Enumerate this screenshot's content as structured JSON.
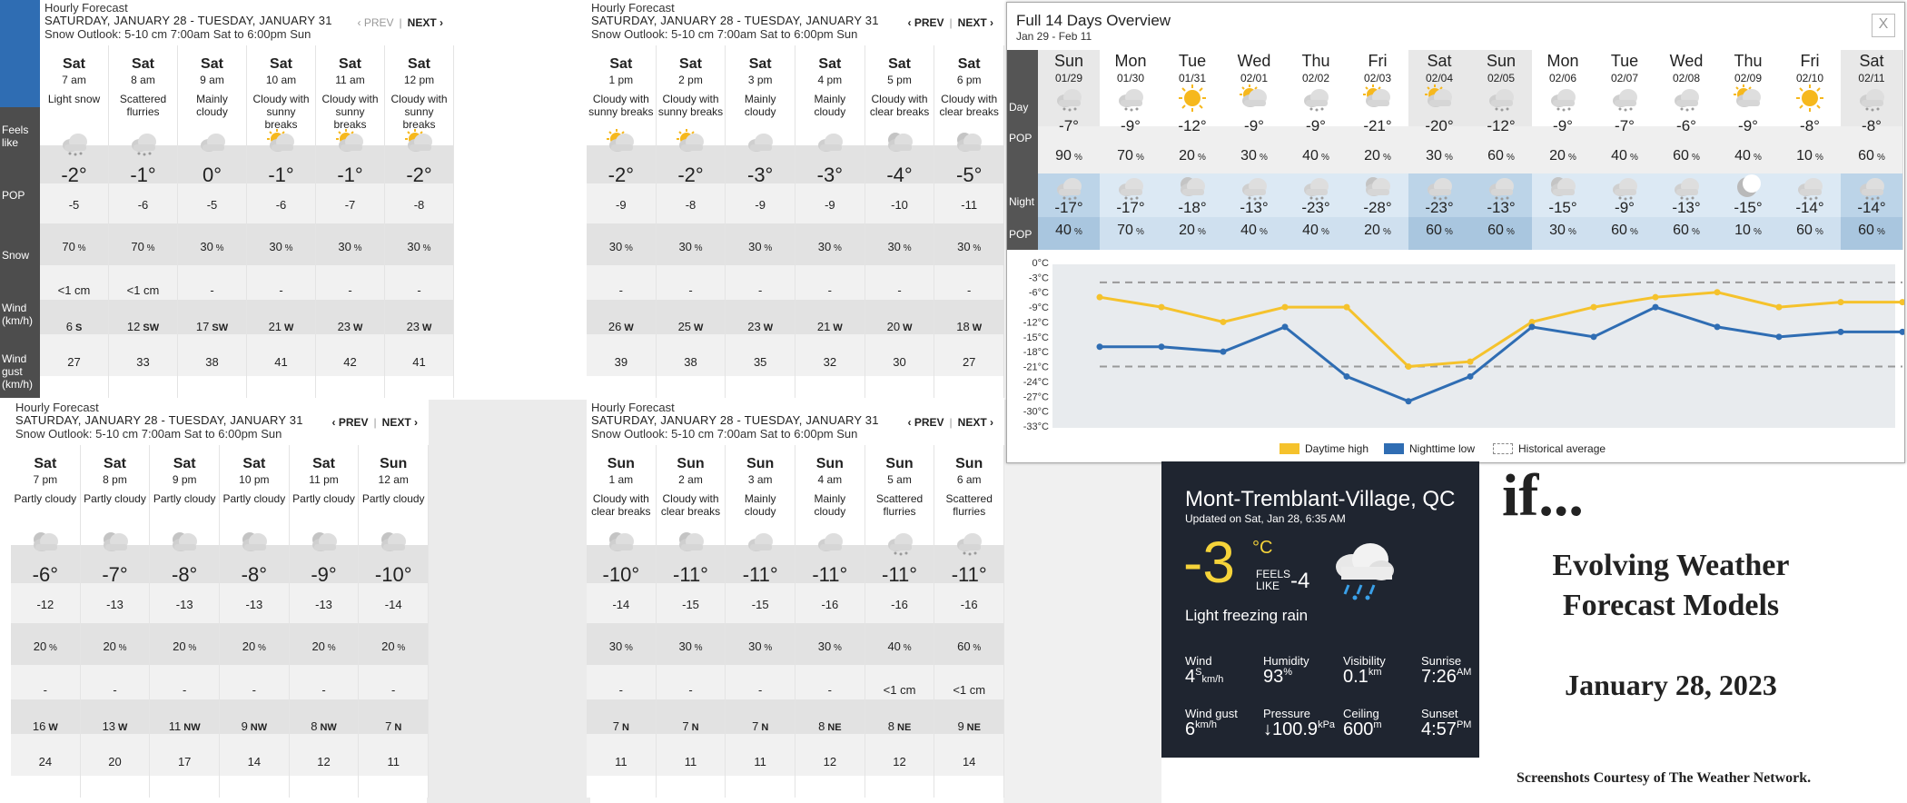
{
  "row_labels": {
    "feels": "Feels like",
    "pop": "POP",
    "snow": "Snow",
    "wind": "Wind (km/h)",
    "gust": "Wind gust (km/h)"
  },
  "hourly_panels": [
    {
      "title": "Hourly Forecast",
      "dates": "SATURDAY, JANUARY 28 - TUESDAY, JANUARY 31",
      "outlook": "Snow Outlook: 5-10 cm 7:00am Sat to 6:00pm Sun",
      "prev": "‹ PREV",
      "next": "NEXT ›",
      "sep": "|",
      "hours": [
        {
          "day": "Sat",
          "hour": "7 am",
          "cond": "Light snow",
          "icon": "snow-cloud-icon",
          "temp": "-2°",
          "feels": "-5",
          "pop": "70",
          "snow": "<1 cm",
          "wind": "6",
          "dir": "S",
          "gust": "27"
        },
        {
          "day": "Sat",
          "hour": "8 am",
          "cond": "Scattered flurries",
          "icon": "flurries-icon",
          "temp": "-1°",
          "feels": "-6",
          "pop": "70",
          "snow": "<1 cm",
          "wind": "12",
          "dir": "SW",
          "gust": "33"
        },
        {
          "day": "Sat",
          "hour": "9 am",
          "cond": "Mainly cloudy",
          "icon": "cloud-icon",
          "temp": "0°",
          "feels": "-5",
          "pop": "30",
          "snow": "-",
          "wind": "17",
          "dir": "SW",
          "gust": "38"
        },
        {
          "day": "Sat",
          "hour": "10 am",
          "cond": "Cloudy with sunny breaks",
          "icon": "sun-cloud-icon",
          "temp": "-1°",
          "feels": "-6",
          "pop": "30",
          "snow": "-",
          "wind": "21",
          "dir": "W",
          "gust": "41"
        },
        {
          "day": "Sat",
          "hour": "11 am",
          "cond": "Cloudy with sunny breaks",
          "icon": "sun-cloud-icon",
          "temp": "-1°",
          "feels": "-7",
          "pop": "30",
          "snow": "-",
          "wind": "23",
          "dir": "W",
          "gust": "42"
        },
        {
          "day": "Sat",
          "hour": "12 pm",
          "cond": "Cloudy with sunny breaks",
          "icon": "sun-cloud-icon",
          "temp": "-2°",
          "feels": "-8",
          "pop": "30",
          "snow": "-",
          "wind": "23",
          "dir": "W",
          "gust": "41"
        }
      ]
    },
    {
      "title": "Hourly Forecast",
      "dates": "SATURDAY, JANUARY 28 - TUESDAY, JANUARY 31",
      "outlook": "Snow Outlook: 5-10 cm 7:00am Sat to 6:00pm Sun",
      "prev": "‹ PREV",
      "next": "NEXT ›",
      "sep": "|",
      "hours": [
        {
          "day": "Sat",
          "hour": "1 pm",
          "cond": "Cloudy with sunny breaks",
          "icon": "sun-cloud-icon",
          "temp": "-2°",
          "feels": "-9",
          "pop": "30",
          "snow": "-",
          "wind": "26",
          "dir": "W",
          "gust": "39"
        },
        {
          "day": "Sat",
          "hour": "2 pm",
          "cond": "Cloudy with sunny breaks",
          "icon": "sun-cloud-icon",
          "temp": "-2°",
          "feels": "-8",
          "pop": "30",
          "snow": "-",
          "wind": "25",
          "dir": "W",
          "gust": "38"
        },
        {
          "day": "Sat",
          "hour": "3 pm",
          "cond": "Mainly cloudy",
          "icon": "cloud-icon",
          "temp": "-3°",
          "feels": "-9",
          "pop": "30",
          "snow": "-",
          "wind": "23",
          "dir": "W",
          "gust": "35"
        },
        {
          "day": "Sat",
          "hour": "4 pm",
          "cond": "Mainly cloudy",
          "icon": "cloud-icon",
          "temp": "-3°",
          "feels": "-9",
          "pop": "30",
          "snow": "-",
          "wind": "21",
          "dir": "W",
          "gust": "32"
        },
        {
          "day": "Sat",
          "hour": "5 pm",
          "cond": "Cloudy with clear breaks",
          "icon": "moon-cloud-icon",
          "temp": "-4°",
          "feels": "-10",
          "pop": "30",
          "snow": "-",
          "wind": "20",
          "dir": "W",
          "gust": "30"
        },
        {
          "day": "Sat",
          "hour": "6 pm",
          "cond": "Cloudy with clear breaks",
          "icon": "moon-cloud-icon",
          "temp": "-5°",
          "feels": "-11",
          "pop": "30",
          "snow": "-",
          "wind": "18",
          "dir": "W",
          "gust": "27"
        }
      ]
    },
    {
      "title": "Hourly Forecast",
      "dates": "SATURDAY, JANUARY 28 - TUESDAY, JANUARY 31",
      "outlook": "Snow Outlook: 5-10 cm 7:00am Sat to 6:00pm Sun",
      "prev": "‹ PREV",
      "next": "NEXT ›",
      "sep": "|",
      "hours": [
        {
          "day": "Sat",
          "hour": "7 pm",
          "cond": "Partly cloudy",
          "icon": "moon-cloud-icon",
          "temp": "-6°",
          "feels": "-12",
          "pop": "20",
          "snow": "-",
          "wind": "16",
          "dir": "W",
          "gust": "24"
        },
        {
          "day": "Sat",
          "hour": "8 pm",
          "cond": "Partly cloudy",
          "icon": "moon-cloud-icon",
          "temp": "-7°",
          "feels": "-13",
          "pop": "20",
          "snow": "-",
          "wind": "13",
          "dir": "W",
          "gust": "20"
        },
        {
          "day": "Sat",
          "hour": "9 pm",
          "cond": "Partly cloudy",
          "icon": "moon-cloud-icon",
          "temp": "-8°",
          "feels": "-13",
          "pop": "20",
          "snow": "-",
          "wind": "11",
          "dir": "NW",
          "gust": "17"
        },
        {
          "day": "Sat",
          "hour": "10 pm",
          "cond": "Partly cloudy",
          "icon": "moon-cloud-icon",
          "temp": "-8°",
          "feels": "-13",
          "pop": "20",
          "snow": "-",
          "wind": "9",
          "dir": "NW",
          "gust": "14"
        },
        {
          "day": "Sat",
          "hour": "11 pm",
          "cond": "Partly cloudy",
          "icon": "moon-cloud-icon",
          "temp": "-9°",
          "feels": "-13",
          "pop": "20",
          "snow": "-",
          "wind": "8",
          "dir": "NW",
          "gust": "12"
        },
        {
          "day": "Sun",
          "hour": "12 am",
          "cond": "Partly cloudy",
          "icon": "moon-cloud-icon",
          "temp": "-10°",
          "feels": "-14",
          "pop": "20",
          "snow": "-",
          "wind": "7",
          "dir": "N",
          "gust": "11"
        }
      ]
    },
    {
      "title": "Hourly Forecast",
      "dates": "SATURDAY, JANUARY 28 - TUESDAY, JANUARY 31",
      "outlook": "Snow Outlook: 5-10 cm 7:00am Sat to 6:00pm Sun",
      "prev": "‹ PREV",
      "next": "NEXT ›",
      "sep": "|",
      "hours": [
        {
          "day": "Sun",
          "hour": "1 am",
          "cond": "Cloudy with clear breaks",
          "icon": "moon-cloud-icon",
          "temp": "-10°",
          "feels": "-14",
          "pop": "30",
          "snow": "-",
          "wind": "7",
          "dir": "N",
          "gust": "11"
        },
        {
          "day": "Sun",
          "hour": "2 am",
          "cond": "Cloudy with clear breaks",
          "icon": "moon-cloud-icon",
          "temp": "-11°",
          "feels": "-15",
          "pop": "30",
          "snow": "-",
          "wind": "7",
          "dir": "N",
          "gust": "11"
        },
        {
          "day": "Sun",
          "hour": "3 am",
          "cond": "Mainly cloudy",
          "icon": "cloud-icon",
          "temp": "-11°",
          "feels": "-15",
          "pop": "30",
          "snow": "-",
          "wind": "7",
          "dir": "N",
          "gust": "11"
        },
        {
          "day": "Sun",
          "hour": "4 am",
          "cond": "Mainly cloudy",
          "icon": "cloud-icon",
          "temp": "-11°",
          "feels": "-16",
          "pop": "30",
          "snow": "-",
          "wind": "8",
          "dir": "NE",
          "gust": "12"
        },
        {
          "day": "Sun",
          "hour": "5 am",
          "cond": "Scattered flurries",
          "icon": "flurries-icon",
          "temp": "-11°",
          "feels": "-16",
          "pop": "40",
          "snow": "<1 cm",
          "wind": "8",
          "dir": "NE",
          "gust": "12"
        },
        {
          "day": "Sun",
          "hour": "6 am",
          "cond": "Scattered flurries",
          "icon": "flurries-icon",
          "temp": "-11°",
          "feels": "-16",
          "pop": "60",
          "snow": "<1 cm",
          "wind": "9",
          "dir": "NE",
          "gust": "14"
        }
      ]
    }
  ],
  "overview": {
    "title": "Full 14 Days Overview",
    "subtitle": "Jan 29 - Feb 11",
    "close": "X",
    "labels": {
      "day": "Day",
      "pop": "POP",
      "night": "Night",
      "npop": "POP"
    },
    "pct": "%",
    "days": [
      {
        "dow": "Sun",
        "date": "01/29",
        "day_icon": "snow-cloud-icon",
        "high": "-7°",
        "dpop": "90",
        "night_icon": "snow-cloud-icon",
        "low": "-17°",
        "npop": "40"
      },
      {
        "dow": "Mon",
        "date": "01/30",
        "day_icon": "snow-cloud-icon",
        "high": "-9°",
        "dpop": "70",
        "night_icon": "snow-cloud-icon",
        "low": "-17°",
        "npop": "70"
      },
      {
        "dow": "Tue",
        "date": "01/31",
        "day_icon": "sun-icon",
        "high": "-12°",
        "dpop": "20",
        "night_icon": "moon-cloud-icon",
        "low": "-18°",
        "npop": "20"
      },
      {
        "dow": "Wed",
        "date": "02/01",
        "day_icon": "sun-cloud-icon",
        "high": "-9°",
        "dpop": "30",
        "night_icon": "snow-cloud-icon",
        "low": "-13°",
        "npop": "40"
      },
      {
        "dow": "Thu",
        "date": "02/02",
        "day_icon": "snow-cloud-icon",
        "high": "-9°",
        "dpop": "40",
        "night_icon": "snow-cloud-icon",
        "low": "-23°",
        "npop": "40"
      },
      {
        "dow": "Fri",
        "date": "02/03",
        "day_icon": "sun-cloud-icon",
        "high": "-21°",
        "dpop": "20",
        "night_icon": "moon-cloud-icon",
        "low": "-28°",
        "npop": "20"
      },
      {
        "dow": "Sat",
        "date": "02/04",
        "day_icon": "sun-cloud-icon",
        "high": "-20°",
        "dpop": "30",
        "night_icon": "snow-cloud-icon",
        "low": "-23°",
        "npop": "60"
      },
      {
        "dow": "Sun",
        "date": "02/05",
        "day_icon": "snow-cloud-icon",
        "high": "-12°",
        "dpop": "60",
        "night_icon": "snow-cloud-icon",
        "low": "-13°",
        "npop": "60"
      },
      {
        "dow": "Mon",
        "date": "02/06",
        "day_icon": "snow-cloud-icon",
        "high": "-9°",
        "dpop": "20",
        "night_icon": "moon-cloud-icon",
        "low": "-15°",
        "npop": "30"
      },
      {
        "dow": "Tue",
        "date": "02/07",
        "day_icon": "snow-cloud-icon",
        "high": "-7°",
        "dpop": "40",
        "night_icon": "snow-cloud-icon",
        "low": "-9°",
        "npop": "60"
      },
      {
        "dow": "Wed",
        "date": "02/08",
        "day_icon": "snow-cloud-icon",
        "high": "-6°",
        "dpop": "60",
        "night_icon": "snow-cloud-icon",
        "low": "-13°",
        "npop": "60"
      },
      {
        "dow": "Thu",
        "date": "02/09",
        "day_icon": "sun-cloud-icon",
        "high": "-9°",
        "dpop": "40",
        "night_icon": "moon-icon",
        "low": "-15°",
        "npop": "10"
      },
      {
        "dow": "Fri",
        "date": "02/10",
        "day_icon": "sun-icon",
        "high": "-8°",
        "dpop": "10",
        "night_icon": "snow-cloud-icon",
        "low": "-14°",
        "npop": "60"
      },
      {
        "dow": "Sat",
        "date": "02/11",
        "day_icon": "snow-cloud-icon",
        "high": "-8°",
        "dpop": "60",
        "night_icon": "snow-cloud-icon",
        "low": "-14°",
        "npop": "60"
      }
    ],
    "chart_data": {
      "type": "line",
      "x": [
        "01/29",
        "01/30",
        "01/31",
        "02/01",
        "02/02",
        "02/03",
        "02/04",
        "02/05",
        "02/06",
        "02/07",
        "02/08",
        "02/09",
        "02/10",
        "02/11"
      ],
      "series": [
        {
          "name": "Daytime high",
          "color": "#f5c22c",
          "values": [
            -7,
            -9,
            -12,
            -9,
            -9,
            -21,
            -20,
            -12,
            -9,
            -7,
            -6,
            -9,
            -8,
            -8
          ]
        },
        {
          "name": "Nighttime low",
          "color": "#2f6db3",
          "values": [
            -17,
            -17,
            -18,
            -13,
            -23,
            -28,
            -23,
            -13,
            -15,
            -9,
            -13,
            -15,
            -14,
            -14
          ]
        },
        {
          "name": "Historical average",
          "color": "#999999",
          "values": [
            -4,
            -4,
            -4,
            -4,
            -4,
            -4,
            -4,
            -4,
            -4,
            -4,
            -4,
            -4,
            -4,
            -4
          ],
          "values_low": [
            -21,
            -21,
            -21,
            -21,
            -21,
            -21,
            -21,
            -21,
            -21,
            -21,
            -21,
            -21,
            -21,
            -21
          ]
        }
      ],
      "yticks": [
        "0°C",
        "-3°C",
        "-6°C",
        "-9°C",
        "-12°C",
        "-15°C",
        "-18°C",
        "-21°C",
        "-24°C",
        "-27°C",
        "-30°C",
        "-33°C"
      ],
      "ylim": [
        -33,
        0
      ],
      "legend": "bottom"
    }
  },
  "current": {
    "location": "Mont-Tremblant-Village, QC",
    "updated": "Updated on Sat, Jan 28, 6:35 AM",
    "temp": "-3",
    "unit": "°C",
    "feels_label": "FEELS LIKE",
    "feels": "-4",
    "condition": "Light freezing rain",
    "wind_label": "Wind",
    "wind": "4",
    "wind_dir": "S",
    "wind_unit": "km/h",
    "humidity_label": "Humidity",
    "humidity": "93",
    "humidity_unit": "%",
    "visibility_label": "Visibility",
    "visibility": "0.1",
    "visibility_unit": "km",
    "sunrise_label": "Sunrise",
    "sunrise": "7:26",
    "sunrise_unit": "AM",
    "gust_label": "Wind gust",
    "gust": "6",
    "gust_unit": "km/h",
    "pressure_label": "Pressure",
    "pressure": "↓100.9",
    "pressure_unit": "kPa",
    "ceiling_label": "Ceiling",
    "ceiling": "600",
    "ceiling_unit": "m",
    "sunset_label": "Sunset",
    "sunset": "4:57",
    "sunset_unit": "PM"
  },
  "caption": {
    "if": "if...",
    "heading1": "Evolving Weather",
    "heading2": "Forecast Models",
    "date": "January 28, 2023",
    "credit": "Screenshots Courtesy of The Weather Network."
  }
}
